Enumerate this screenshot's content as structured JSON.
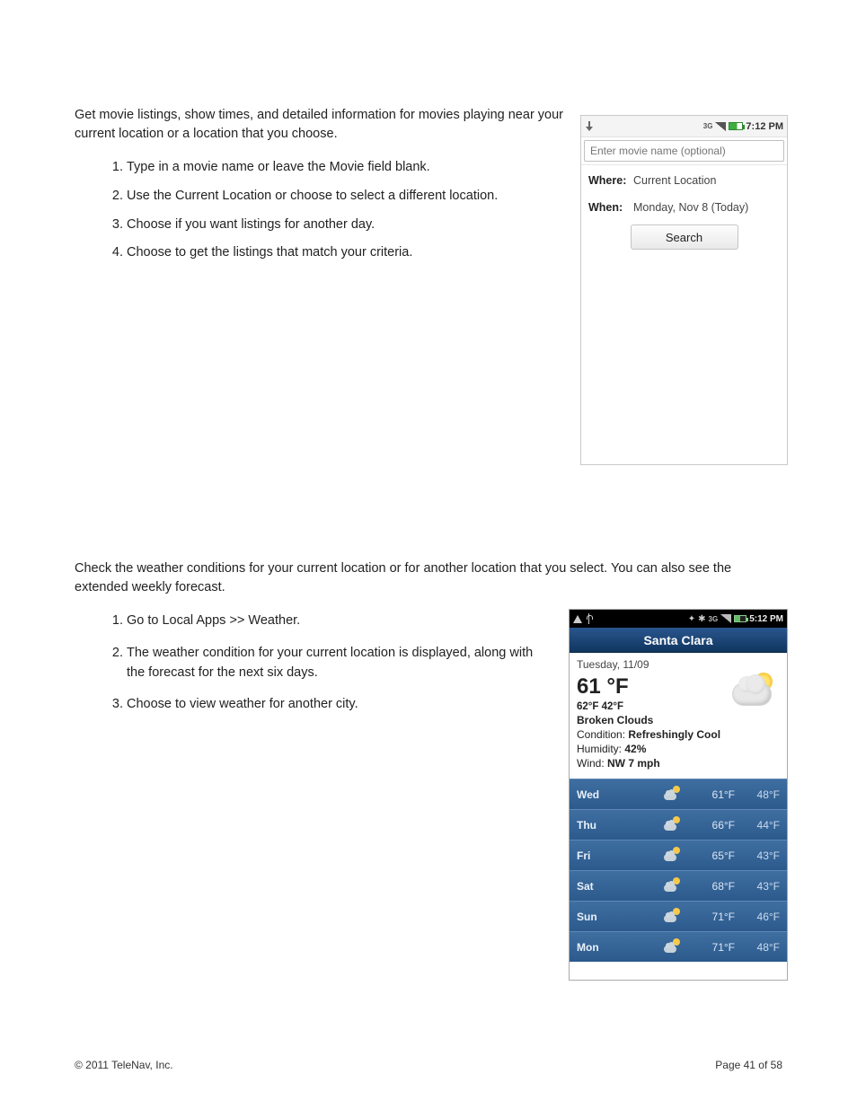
{
  "movies": {
    "intro": "Get movie listings, show times, and detailed information for movies playing near your current location or a location that you choose.",
    "steps": [
      "Type in a movie name or leave the Movie field blank.",
      "Use the Current Location or choose             to select a different location.",
      "Choose            if you want listings for another day.",
      "Choose             to get the listings that match your criteria."
    ]
  },
  "movie_phone": {
    "status_time": "7:12 PM",
    "input_placeholder": "Enter movie name (optional)",
    "where_label": "Where:",
    "where_value": "Current Location",
    "when_label": "When:",
    "when_value": "Monday, Nov 8 (Today)",
    "search_label": "Search"
  },
  "weather": {
    "intro": "Check the weather conditions for your current location or for another location that you select. You can also see the extended weekly forecast.",
    "steps": [
      "Go to Local Apps >> Weather.",
      "The weather condition for your current location is displayed, along with the forecast for the next six days.",
      "Choose                             to view weather for another city."
    ]
  },
  "weather_phone": {
    "status_time": "5:12 PM",
    "city": "Santa Clara",
    "date": "Tuesday, 11/09",
    "temp": "61 °F",
    "hi_lo": "62°F  42°F",
    "desc": "Broken Clouds",
    "condition_label": "Condition: ",
    "condition_value": "Refreshingly Cool",
    "humidity_label": "Humidity: ",
    "humidity_value": "42%",
    "wind_label": "Wind: ",
    "wind_value": "NW 7 mph",
    "forecast": [
      {
        "day": "Wed",
        "hi": "61°F",
        "lo": "48°F"
      },
      {
        "day": "Thu",
        "hi": "66°F",
        "lo": "44°F"
      },
      {
        "day": "Fri",
        "hi": "65°F",
        "lo": "43°F"
      },
      {
        "day": "Sat",
        "hi": "68°F",
        "lo": "43°F"
      },
      {
        "day": "Sun",
        "hi": "71°F",
        "lo": "46°F"
      },
      {
        "day": "Mon",
        "hi": "71°F",
        "lo": "48°F"
      }
    ]
  },
  "footer": {
    "copyright": "© 2011 TeleNav, Inc.",
    "page": "Page 41 of 58"
  }
}
